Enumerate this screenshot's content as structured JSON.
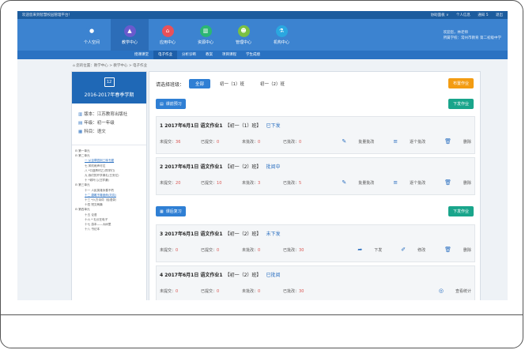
{
  "topbar": {
    "welcome": "欢迎您来到智慧校园管理平台！",
    "links": [
      "协助面板 ∨",
      "个人信息",
      "通知 5",
      "退出"
    ]
  },
  "nav": {
    "items": [
      {
        "label": "个人空间",
        "icon": "person-icon",
        "color": "#3c83d0"
      },
      {
        "label": "教学中心",
        "icon": "graduation-cap-icon",
        "color": "#6a5acd"
      },
      {
        "label": "应用中心",
        "icon": "home-icon",
        "color": "#e8515a"
      },
      {
        "label": "资源中心",
        "icon": "book-icon",
        "color": "#2bb673"
      },
      {
        "label": "管理中心",
        "icon": "user-admin-icon",
        "color": "#7ac143"
      },
      {
        "label": "机构中心",
        "icon": "flask-icon",
        "color": "#2aa7e0"
      }
    ],
    "active_index": 1
  },
  "user": {
    "line1": "欢迎您，林老师",
    "line2": "所属学校：常州市教育  第二初级中学"
  },
  "subnav": {
    "items": [
      "授课课堂",
      "电子作业",
      "分析诊断",
      "教案",
      "项目课程",
      "学生成绩"
    ],
    "active_index": 1
  },
  "breadcrumb": "您的位置：教学中心 > 教学中心 > 电子作业",
  "sidebar": {
    "term": "2016-2017年春季学期",
    "calendar_day": "12",
    "meta": [
      {
        "label": "版本：江苏教育出版社",
        "icon": "book-icon"
      },
      {
        "label": "年级：初一年级",
        "icon": "grade-icon"
      },
      {
        "label": "科目：语文",
        "icon": "subject-icon"
      }
    ],
    "tree": [
      {
        "text": "⊟ 第一单元",
        "level": 1
      },
      {
        "text": "⊟ 第二单元",
        "level": 1
      },
      {
        "text": "一 从百草园到三味书屋",
        "level": 2,
        "selected": true
      },
      {
        "text": "七 风吹雨声可达",
        "level": 2
      },
      {
        "text": "八 *口蓝昨时乙(同学们)",
        "level": 2
      },
      {
        "text": "九 我们的开学典礼(王安亿)",
        "level": 2
      },
      {
        "text": "十 *城叶儿(汪学谦)",
        "level": 2
      },
      {
        "text": "⊟ 第三单元",
        "level": 1
      },
      {
        "text": "十一 人民英雄永垂不朽",
        "level": 2
      },
      {
        "text": "十二 唐雎不辱使命(刘向)",
        "level": 2,
        "selected": true
      },
      {
        "text": "十三 *六方诗词（俗语录）",
        "level": 2
      },
      {
        "text": "十四 短文两篇",
        "level": 2
      },
      {
        "text": "⊟ 第四单元",
        "level": 1
      },
      {
        "text": "十五 论语",
        "level": 2
      },
      {
        "text": "十六 * 礼仪在电子",
        "level": 2
      },
      {
        "text": "十七 游本——大树里",
        "level": 2
      },
      {
        "text": "十八 书记本",
        "level": 2
      }
    ]
  },
  "main": {
    "filter_label": "请选择班级：",
    "filters": [
      "全部",
      "初一（1）班",
      "初一（2）班"
    ],
    "active_filter": 0,
    "publish_label": "布置作业",
    "sections": [
      {
        "label": "课前预习",
        "icon": "preview-icon",
        "action": "下发作业"
      },
      {
        "label": "课后复习",
        "icon": "review-icon",
        "action": "下发作业"
      }
    ],
    "stat_labels": [
      "未提交：",
      "已提交：",
      "未批改：",
      "已批改："
    ],
    "cards": [
      {
        "no": "1",
        "title": "2017年6月1日 语文作业1",
        "cls": "【初一（1）班】",
        "status": "已下发",
        "stats": [
          "36",
          "0",
          "0",
          "0"
        ],
        "actions": [
          {
            "label": "批量批改",
            "icon": "batch-edit-icon"
          },
          {
            "label": "逐个批改",
            "icon": "edit-list-icon"
          },
          {
            "label": "删除",
            "icon": "trash-icon"
          }
        ]
      },
      {
        "no": "2",
        "title": "2017年6月1日 语文作业1",
        "cls": "【初一（2）班】",
        "status": "批阅中",
        "stats": [
          "20",
          "10",
          "3",
          "5"
        ],
        "actions": [
          {
            "label": "批量批改",
            "icon": "batch-edit-icon"
          },
          {
            "label": "逐个批改",
            "icon": "edit-list-icon"
          },
          {
            "label": "删除",
            "icon": "trash-icon"
          }
        ]
      },
      {
        "no": "3",
        "title": "2017年6月1日 语文作业1",
        "cls": "【初一（2）班】",
        "status": "未下发",
        "stats": [
          "0",
          "0",
          "0",
          "30"
        ],
        "actions": [
          {
            "label": "下发",
            "icon": "send-icon"
          },
          {
            "label": "修改",
            "icon": "pencil-icon"
          },
          {
            "label": "删除",
            "icon": "trash-icon"
          }
        ]
      },
      {
        "no": "4",
        "title": "2017年6月1日 语文作业1",
        "cls": "【初一（2）班】",
        "status": "已批阅",
        "stats": [
          "0",
          "0",
          "0",
          "30"
        ],
        "actions": [
          {
            "label": "查看统计",
            "icon": "stats-icon"
          }
        ]
      }
    ]
  }
}
